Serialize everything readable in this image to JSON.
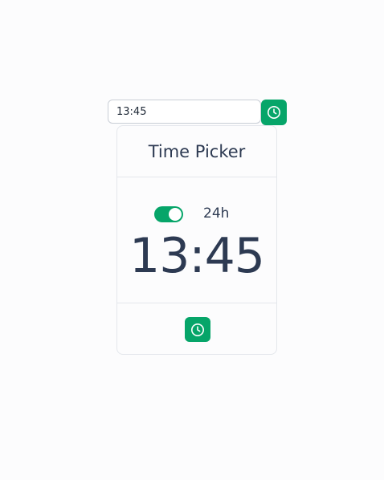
{
  "input": {
    "value": "13:45",
    "icon": "clock-icon"
  },
  "panel": {
    "title": "Time Picker",
    "format_toggle": {
      "label": "24h",
      "on": true
    },
    "time_display": "13:45",
    "footer": {
      "icon": "clock-icon"
    }
  },
  "colors": {
    "accent": "#06a569",
    "text": "#2d3a52",
    "border": "#e4e7ec",
    "background": "#fcfcfd"
  }
}
